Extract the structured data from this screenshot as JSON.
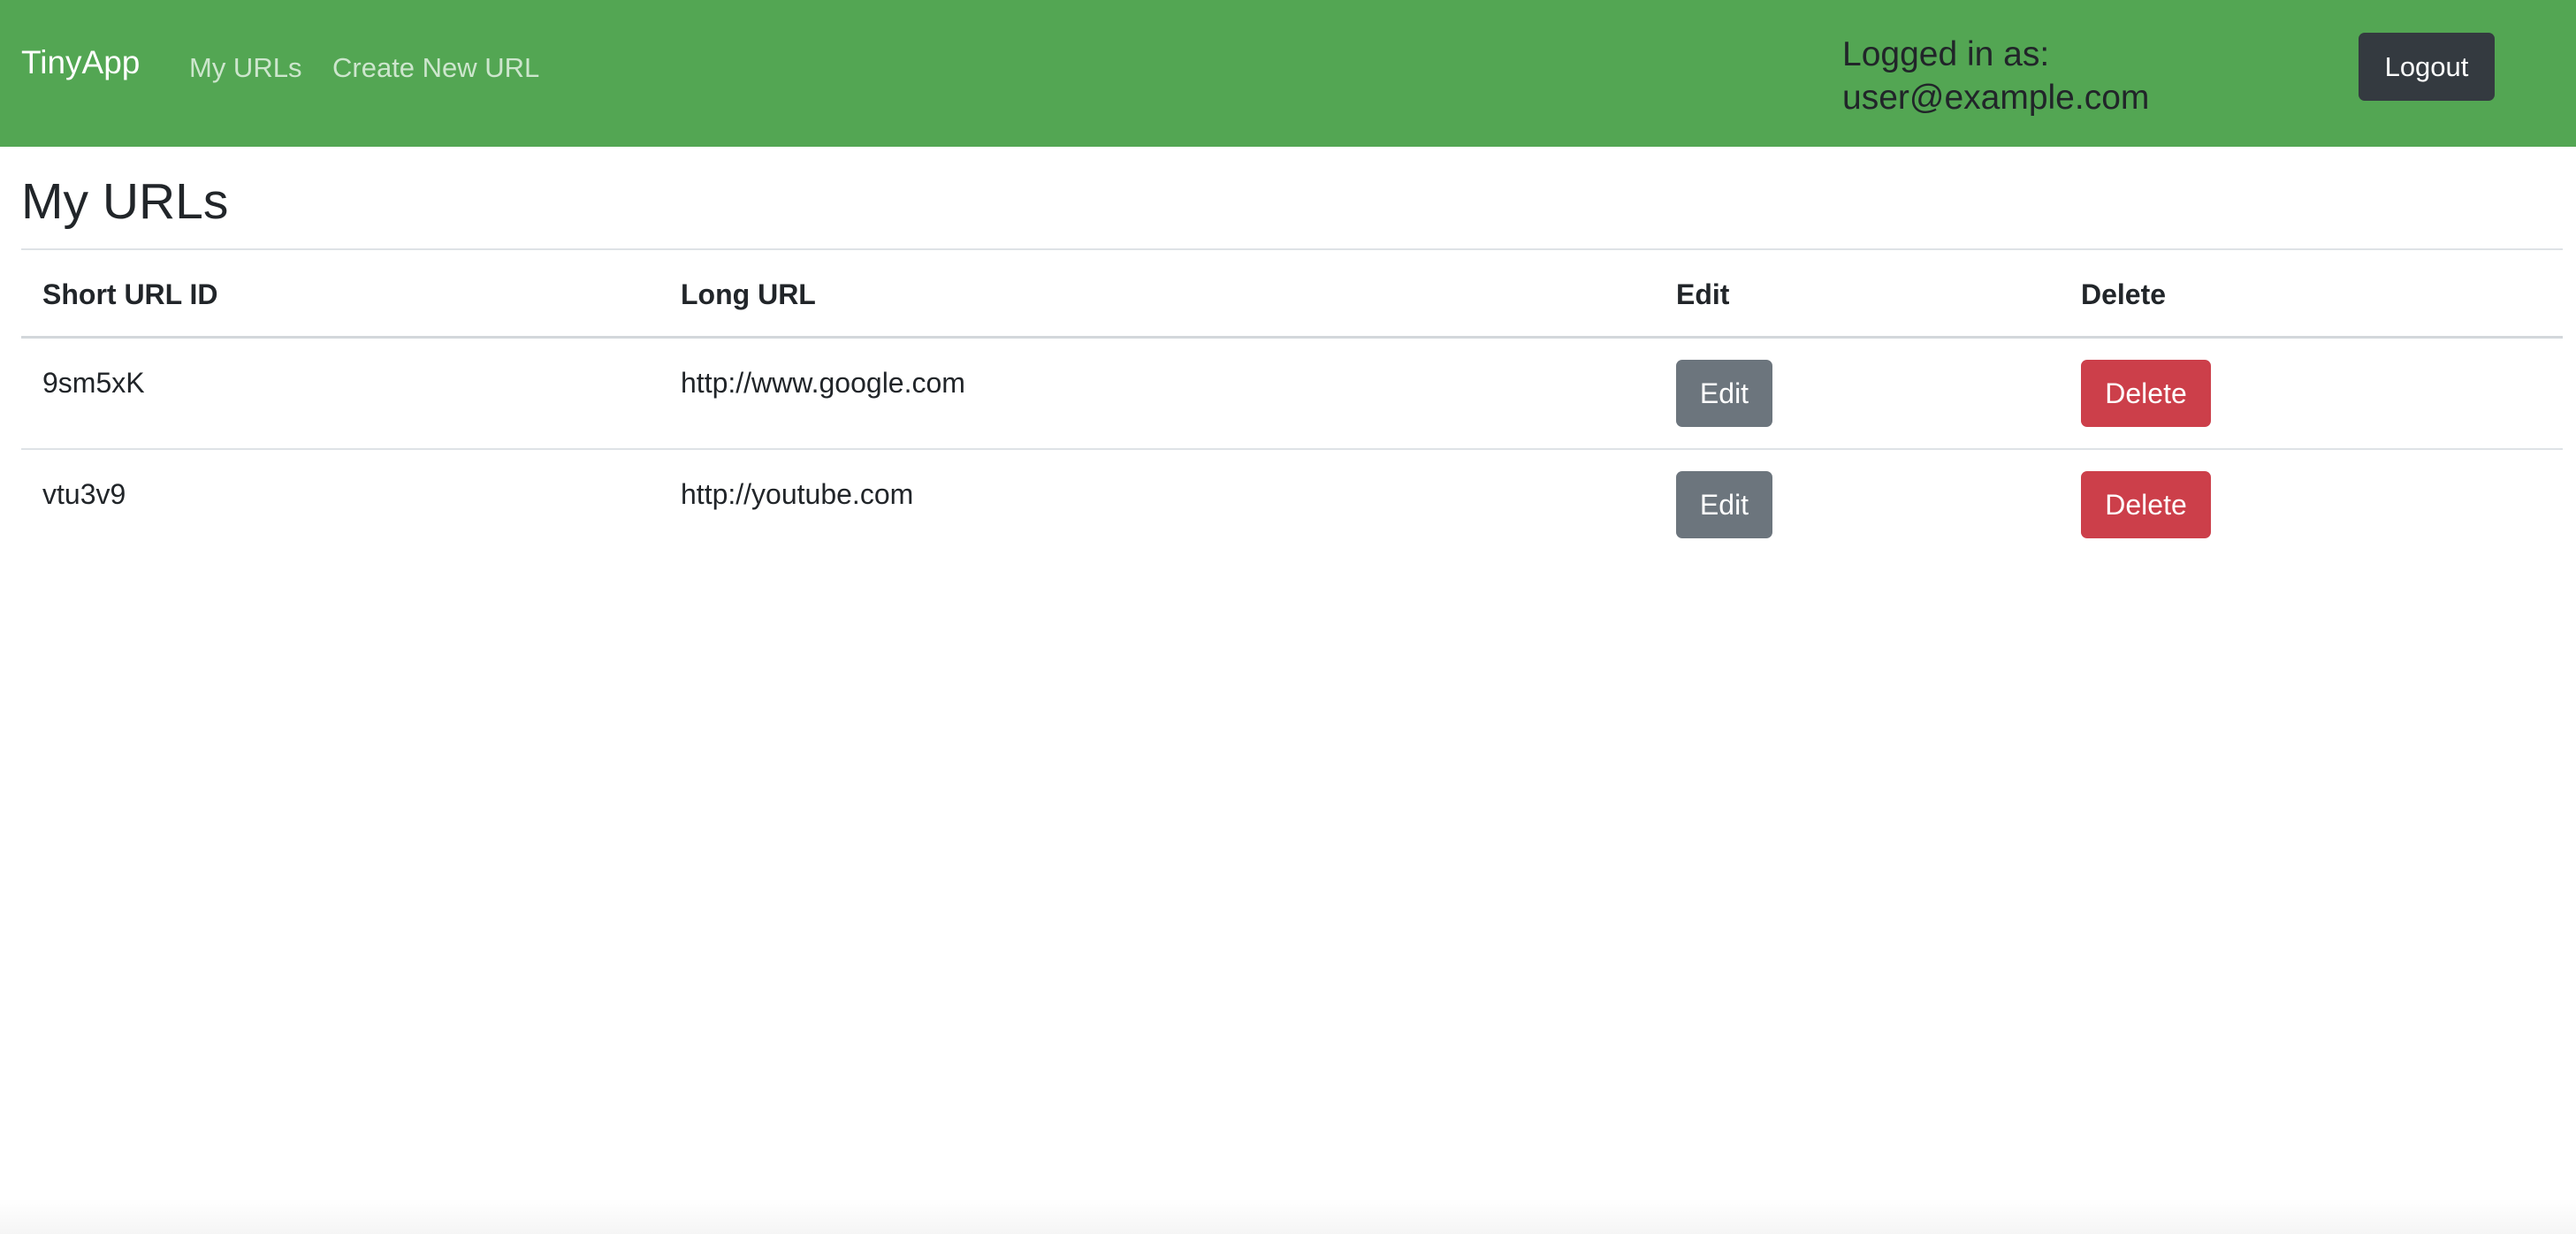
{
  "navbar": {
    "brand": "TinyApp",
    "links": [
      "My URLs",
      "Create New URL"
    ],
    "login_label": "Logged in as:",
    "user_email": "user@example.com",
    "logout_label": "Logout",
    "background_color": "#53a653"
  },
  "main": {
    "title": "My URLs",
    "table": {
      "headers": [
        "Short URL ID",
        "Long URL",
        "Edit",
        "Delete"
      ],
      "rows": [
        {
          "short_id": "9sm5xK",
          "long_url": "http://www.google.com",
          "edit_label": "Edit",
          "delete_label": "Delete"
        },
        {
          "short_id": "vtu3v9",
          "long_url": "http://youtube.com",
          "edit_label": "Edit",
          "delete_label": "Delete"
        }
      ]
    }
  },
  "colors": {
    "edit_button": "#6c757d",
    "delete_button": "#cc3f4a",
    "logout_button": "#343a40"
  }
}
